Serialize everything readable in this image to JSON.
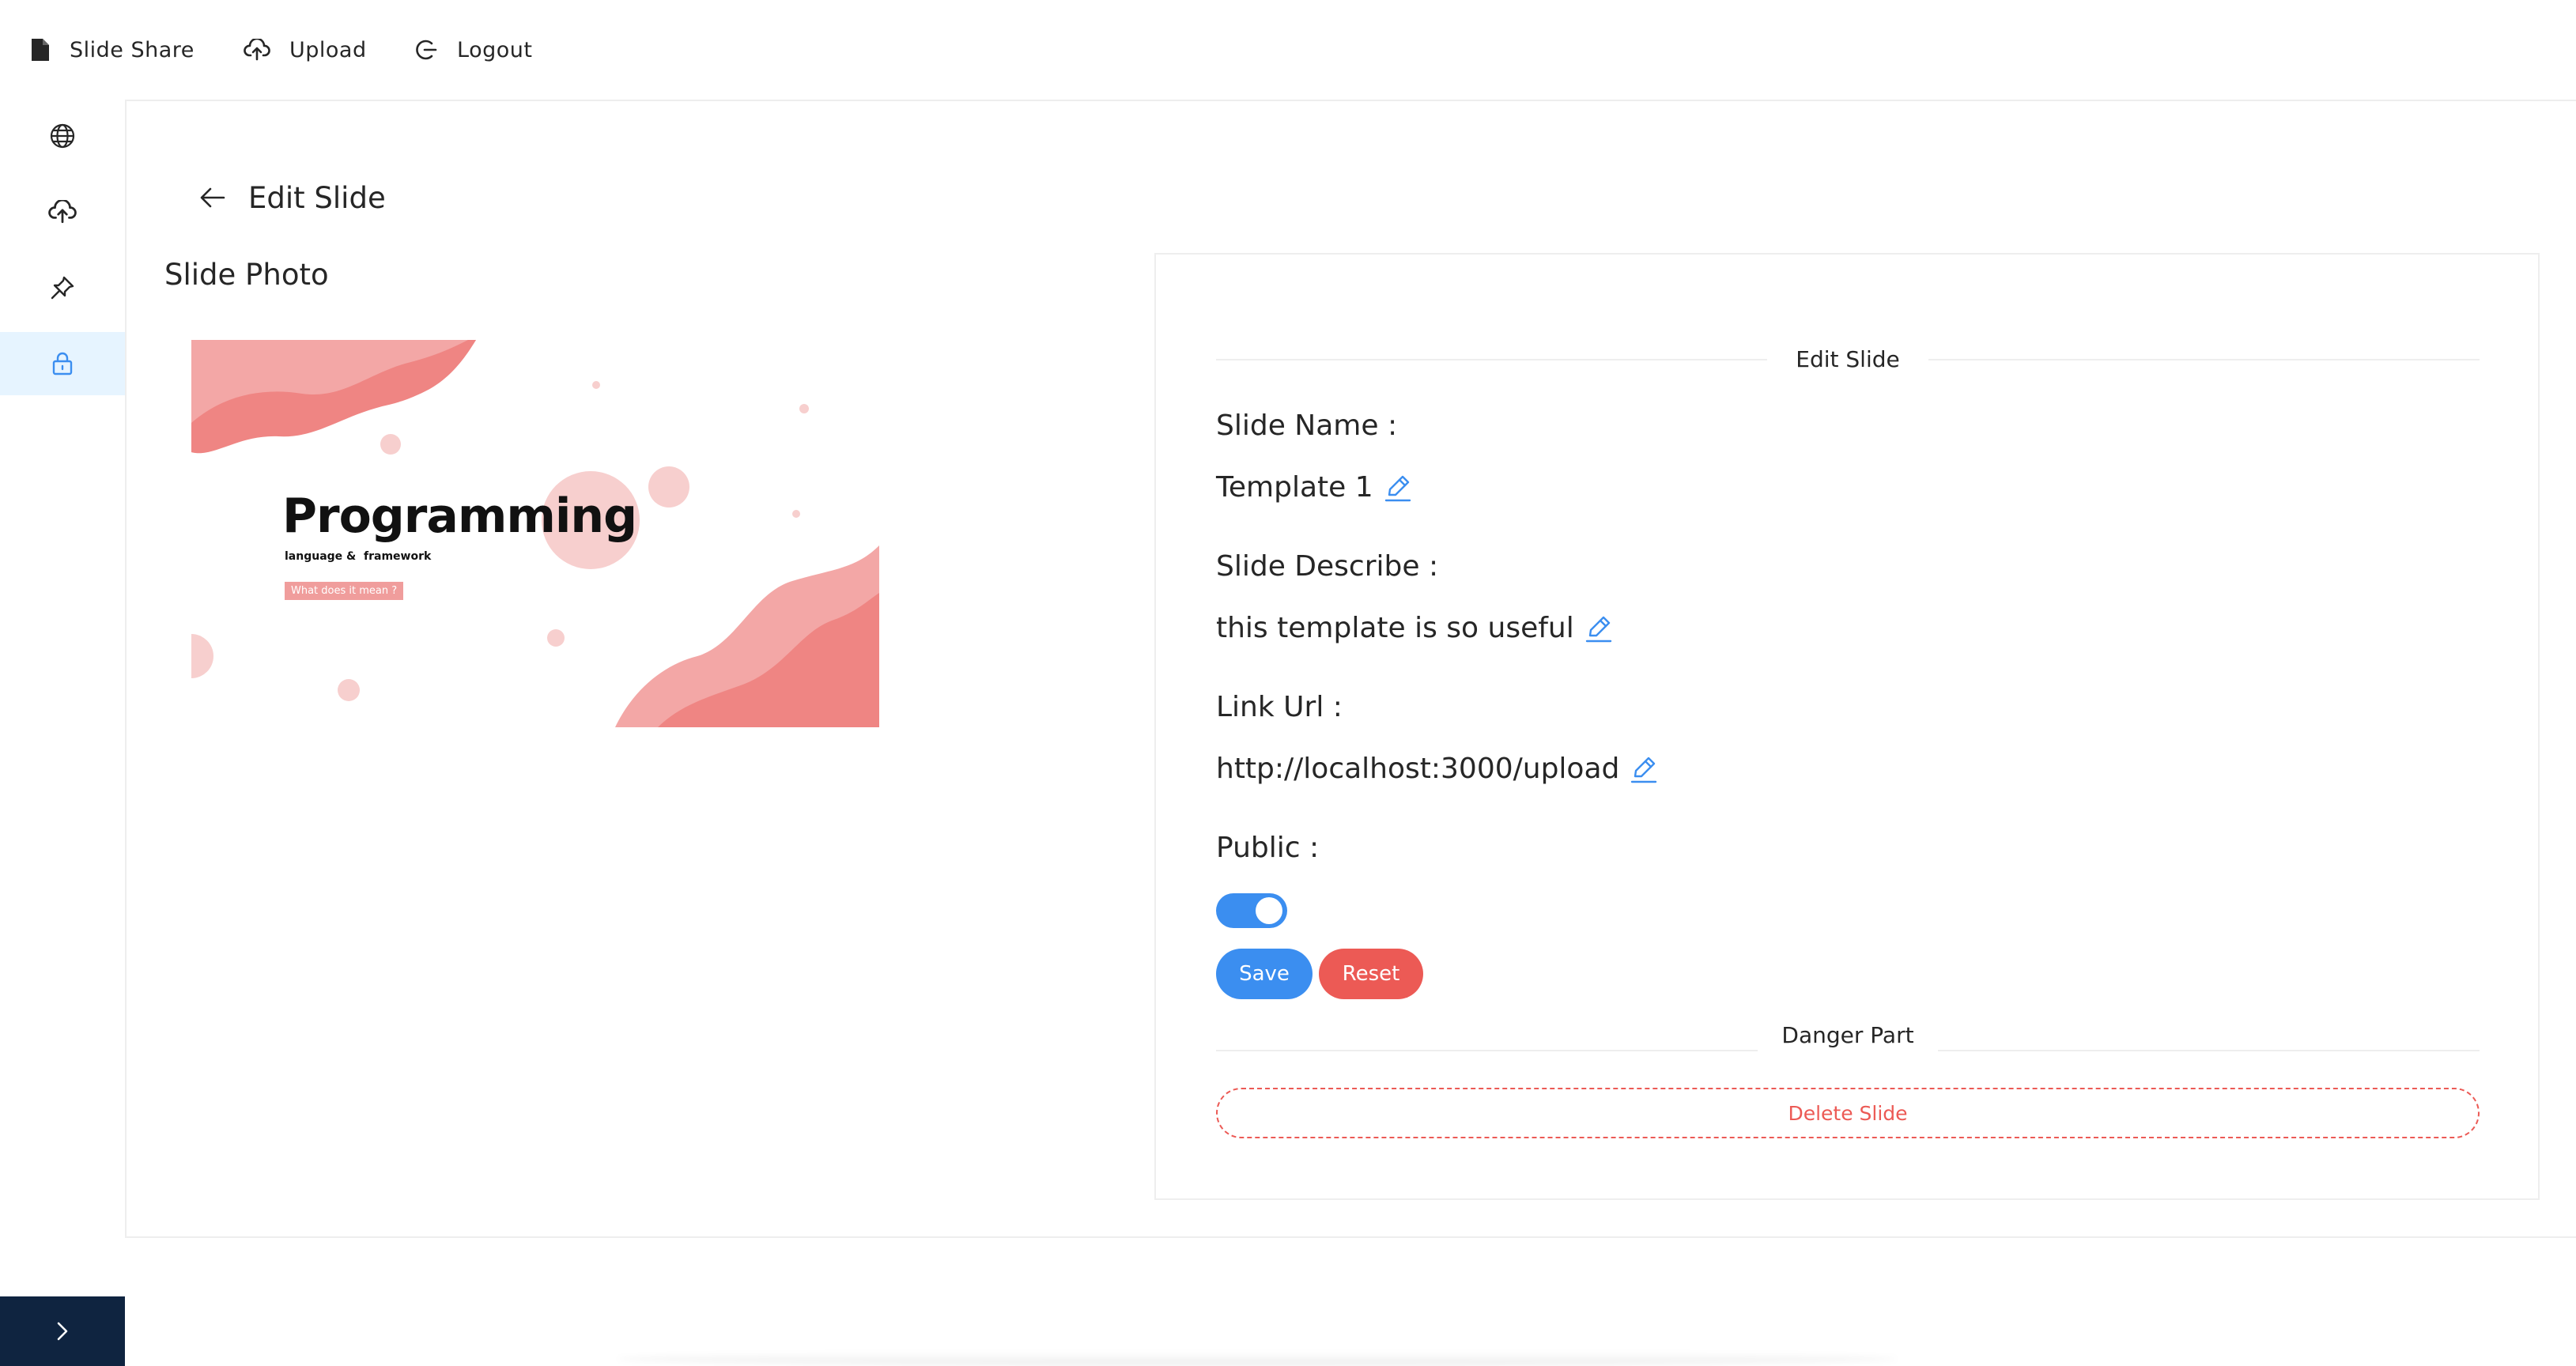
{
  "topnav": {
    "brand": "Slide Share",
    "upload": "Upload",
    "logout": "Logout"
  },
  "sidebar": {
    "items": [
      {
        "icon": "globe-icon"
      },
      {
        "icon": "cloud-upload-icon"
      },
      {
        "icon": "pin-icon"
      },
      {
        "icon": "lock-icon",
        "active": true
      }
    ],
    "toggle_icon": "chevron-right-icon"
  },
  "page": {
    "title": "Edit Slide",
    "photo_label": "Slide Photo"
  },
  "thumbnail": {
    "heading": "Programming",
    "subheading": "language &  framework",
    "tag": "What does it mean ?"
  },
  "form": {
    "section_title": "Edit Slide",
    "name_label": "Slide Name :",
    "name_value": "Template 1",
    "describe_label": "Slide Describe :",
    "describe_value": "this template is so useful",
    "url_label": "Link Url :",
    "url_value": "http://localhost:3000/upload",
    "public_label": "Public :",
    "public_value": true,
    "save_label": "Save",
    "reset_label": "Reset",
    "danger_title": "Danger Part",
    "delete_label": "Delete Slide"
  },
  "colors": {
    "primary": "#3b8ef0",
    "danger": "#ec5a55",
    "sidebar_active": "#e6f4ff",
    "sidebar_toggle": "#0f2440",
    "thumb_pink_light": "#f3a7a6",
    "thumb_pink_dark": "#ef8583"
  }
}
